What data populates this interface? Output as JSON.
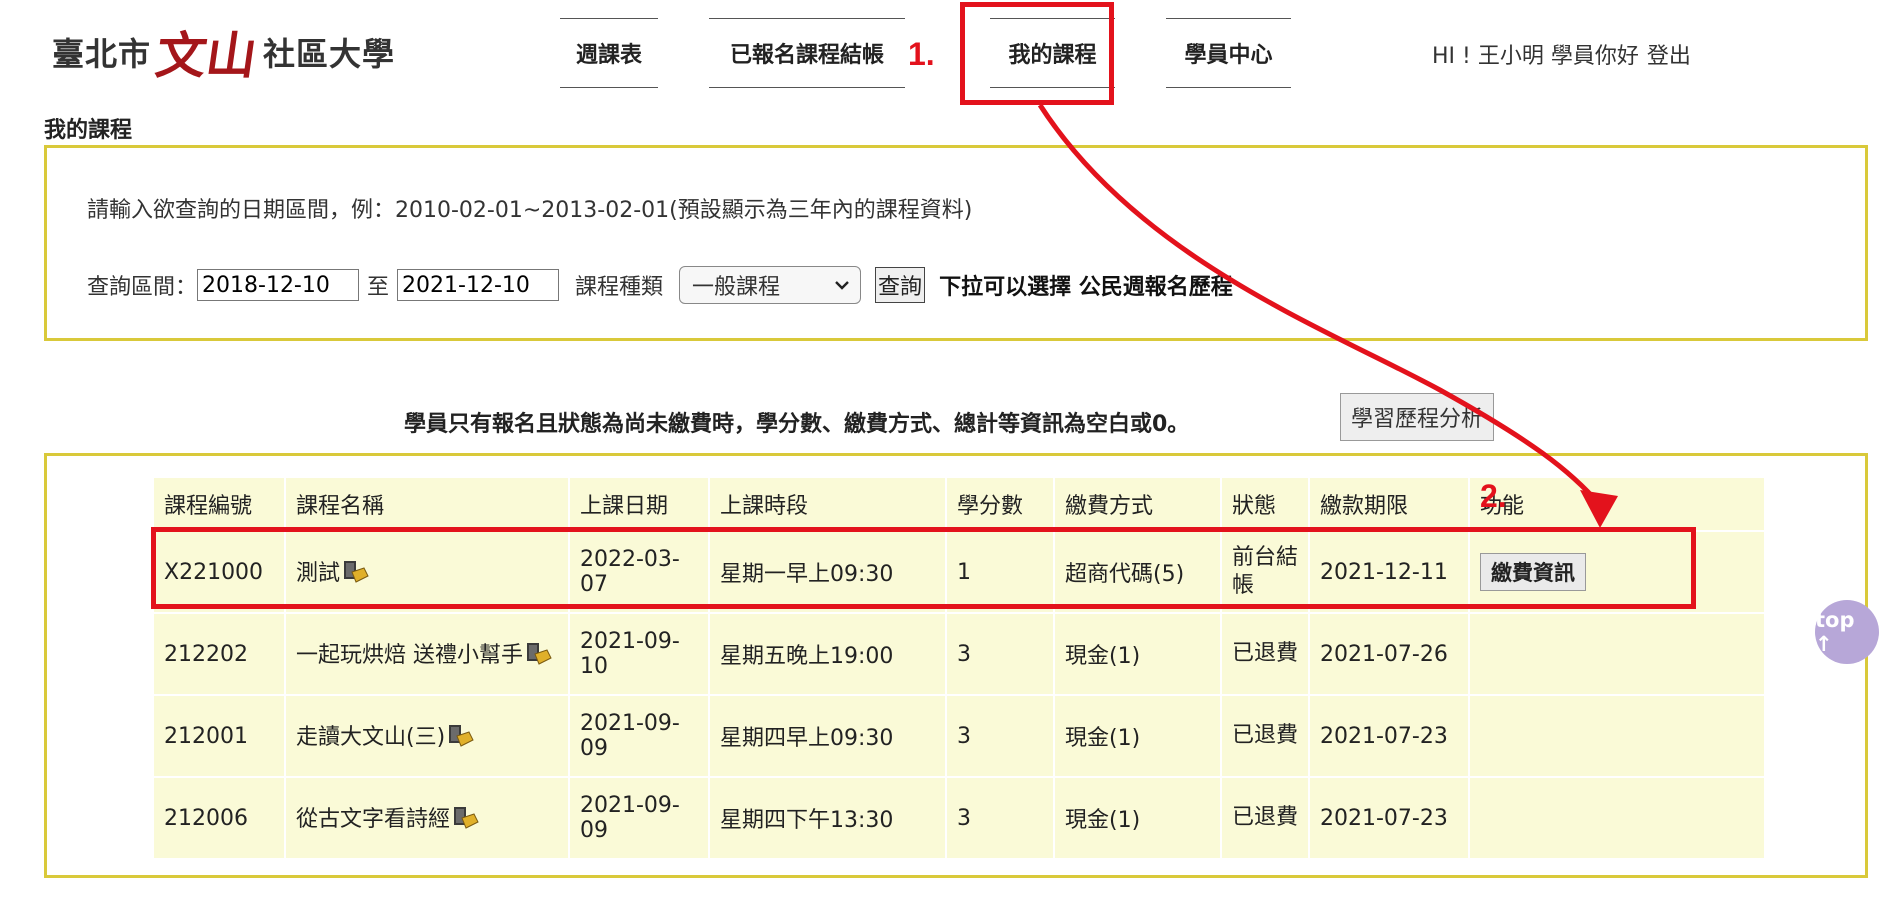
{
  "logo": {
    "part1": "臺北市",
    "part2": "文山",
    "part3": "社區大學"
  },
  "nav": [
    {
      "label": "週課表"
    },
    {
      "label": "已報名課程結帳"
    },
    {
      "label": "我的課程"
    },
    {
      "label": "學員中心"
    }
  ],
  "user": {
    "greeting": "HI ! 王小明 學員你好",
    "logout": "登出"
  },
  "page_title": "我的課程",
  "search": {
    "hint": "請輸入欲查詢的日期區間，例：2010-02-01~2013-02-01(預設顯示為三年內的課程資料)",
    "range_label": "查詢區間：",
    "start_date": "2018-12-10",
    "to_label": "至",
    "end_date": "2021-12-10",
    "type_label": "課程種類",
    "type_selected": "一般課程",
    "query_button": "查詢",
    "select_note": "下拉可以選擇 公民週報名歷程"
  },
  "notice": "學員只有報名且狀態為尚未繳費時，學分數、繳費方式、總計等資訊為空白或0。",
  "analysis_button": "學習歷程分析",
  "table": {
    "headers": [
      "課程編號",
      "課程名稱",
      "上課日期",
      "上課時段",
      "學分數",
      "繳費方式",
      "狀態",
      "繳款期限",
      "功能"
    ],
    "rows": [
      {
        "id": "X221000",
        "name": "測試",
        "date": "2022-03-07",
        "time": "星期一早上09:30",
        "credits": "1",
        "payment": "超商代碼(5)",
        "status": "前台結帳",
        "deadline": "2021-12-11",
        "action": "繳費資訊"
      },
      {
        "id": "212202",
        "name": "一起玩烘焙 送禮小幫手",
        "date": "2021-09-10",
        "time": "星期五晚上19:00",
        "credits": "3",
        "payment": "現金(1)",
        "status": "已退費",
        "deadline": "2021-07-26",
        "action": ""
      },
      {
        "id": "212001",
        "name": "走讀大文山(三)",
        "date": "2021-09-09",
        "time": "星期四早上09:30",
        "credits": "3",
        "payment": "現金(1)",
        "status": "已退費",
        "deadline": "2021-07-23",
        "action": ""
      },
      {
        "id": "212006",
        "name": "從古文字看詩經",
        "date": "2021-09-09",
        "time": "星期四下午13:30",
        "credits": "3",
        "payment": "現金(1)",
        "status": "已退費",
        "deadline": "2021-07-23",
        "action": ""
      }
    ]
  },
  "top_button": "top ↑",
  "annotations": {
    "step1": "1.",
    "step2": "2.",
    "color": "#e3121c"
  }
}
